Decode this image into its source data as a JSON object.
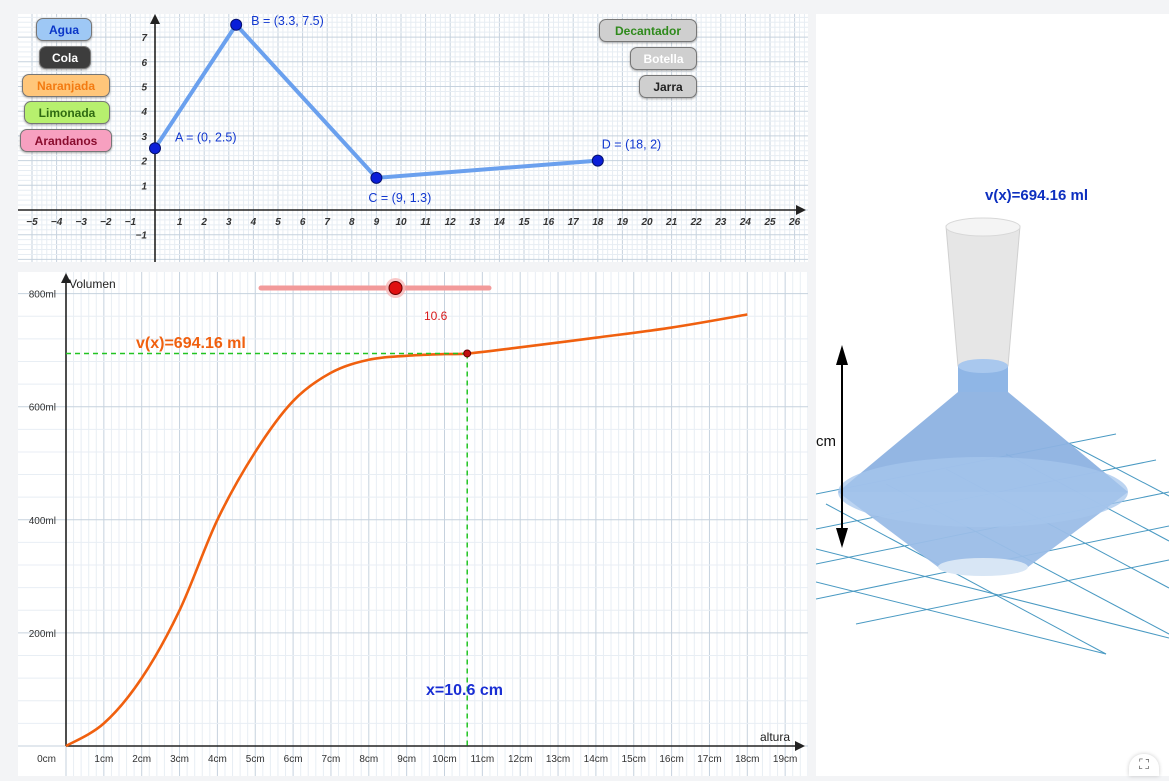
{
  "top_graph": {
    "buttons_left": [
      {
        "label": "Agua",
        "bg": "#9ec8f5",
        "color": "#0a36c8"
      },
      {
        "label": "Cola",
        "bg": "#3d3d3d",
        "color": "#ffffff"
      },
      {
        "label": "Naranjada",
        "bg": "#ffc67a",
        "color": "#f37b12"
      },
      {
        "label": "Limonada",
        "bg": "#b7f06e",
        "color": "#2f6a12"
      },
      {
        "label": "Arandanos",
        "bg": "#f7a0c0",
        "color": "#8a0c2e"
      }
    ],
    "buttons_right": [
      {
        "label": "Decantador",
        "bg": "#cfcfcf",
        "color": "#2f8a1c"
      },
      {
        "label": "Botella",
        "bg": "#cfcfcf",
        "color": "#ffffff"
      },
      {
        "label": "Jarra",
        "bg": "#cfcfcf",
        "color": "#222222"
      }
    ],
    "x_ticks": [
      "−5",
      "−4",
      "−3",
      "−2",
      "−1",
      "1",
      "2",
      "3",
      "4",
      "5",
      "6",
      "7",
      "8",
      "9",
      "10",
      "11",
      "12",
      "13",
      "14",
      "15",
      "16",
      "17",
      "18",
      "19",
      "20",
      "21",
      "22",
      "23",
      "24",
      "25",
      "26"
    ],
    "y_ticks": [
      "1",
      "2",
      "3",
      "4",
      "5",
      "6",
      "7",
      "−1"
    ],
    "points": [
      {
        "label": "A = (0, 2.5)",
        "x": 0,
        "y": 2.5
      },
      {
        "label": "B = (3.3, 7.5)",
        "x": 3.3,
        "y": 7.5
      },
      {
        "label": "C = (9, 1.3)",
        "x": 9,
        "y": 1.3
      },
      {
        "label": "D = (18, 2)",
        "x": 18,
        "y": 2
      }
    ],
    "line_color": "#6aa0ee",
    "point_color": "#0a1ed8"
  },
  "bottom_graph": {
    "y_axis_title": "Volumen",
    "x_axis_title": "altura",
    "y_ticks": [
      "0cm",
      "200ml",
      "400ml",
      "600ml",
      "800ml"
    ],
    "x_ticks": [
      "1cm",
      "2cm",
      "3cm",
      "4cm",
      "5cm",
      "6cm",
      "7cm",
      "8cm",
      "9cm",
      "10cm",
      "11cm",
      "12cm",
      "13cm",
      "14cm",
      "15cm",
      "16cm",
      "17cm",
      "18cm",
      "19cm"
    ],
    "volume_label": "v(x)=694.16 ml",
    "x_label": "x=10.6 cm",
    "slider_value": "10.6",
    "slider_fraction": 0.59,
    "curve_color": "#f0600f",
    "guide_color": "#22c422",
    "point_x": 10.6,
    "point_y": 694.16
  },
  "chart_data": {
    "type": "line",
    "xlabel": "altura",
    "ylabel": "Volumen",
    "xlim": [
      0,
      19
    ],
    "ylim": [
      0,
      800
    ],
    "series": [
      {
        "name": "v(x)",
        "x": [
          0,
          1,
          2,
          3,
          4,
          5,
          6,
          7,
          8,
          9,
          10,
          10.6,
          12,
          14,
          16,
          18
        ],
        "y": [
          0,
          40,
          120,
          240,
          400,
          520,
          610,
          660,
          683,
          690,
          693,
          694,
          705,
          722,
          740,
          763
        ]
      }
    ]
  },
  "right_panel": {
    "volume_label": "v(x)=694.16 ml",
    "dim_label": "cm"
  }
}
